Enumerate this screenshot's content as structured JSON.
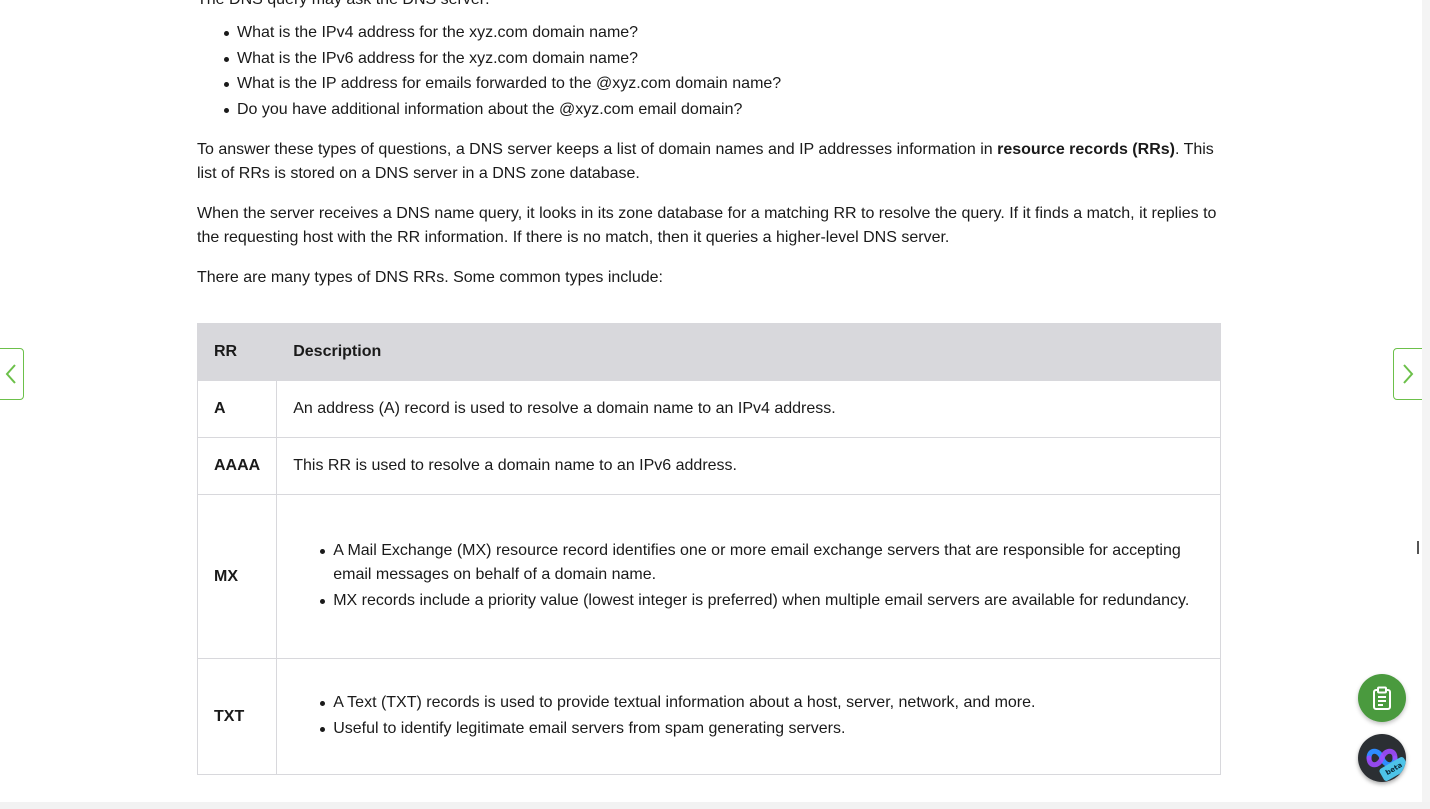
{
  "content": {
    "intro": "The DNS query may ask the DNS server:",
    "questions": [
      "What is the IPv4 address for the xyz.com domain name?",
      "What is the IPv6 address for the xyz.com domain name?",
      "What is the IP address for emails forwarded to the @xyz.com domain name?",
      "Do you have additional information about the @xyz.com email domain?"
    ],
    "para1_before": "To answer these types of questions, a DNS server keeps a list of domain names and IP addresses information in ",
    "para1_bold": "resource records (RRs)",
    "para1_after": ". This list of RRs is stored on a DNS server in a DNS zone database.",
    "para2": "When the server receives a DNS name query, it looks in its zone database for a matching RR to resolve the query. If it finds a match, it replies to the requesting host with the RR information. If there is no match, then it queries a higher-level DNS server.",
    "para3": "There are many types of DNS RRs. Some common types include:"
  },
  "table": {
    "headers": {
      "rr": "RR",
      "description": "Description"
    },
    "rows": [
      {
        "rr": "A",
        "description": "An address (A) record is used to resolve a domain name to an IPv4 address."
      },
      {
        "rr": "AAAA",
        "description": "This RR is used to resolve a domain name to an IPv6 address."
      },
      {
        "rr": "MX",
        "bullets": [
          "A Mail Exchange (MX) resource record identifies one or more email exchange servers that are responsible for accepting email messages on behalf of a domain name.",
          "MX records include a priority value (lowest integer is preferred) when multiple email servers are available for redundancy."
        ]
      },
      {
        "rr": "TXT",
        "bullets": [
          "A Text (TXT) records is used to provide textual information about a host, server, network, and more.",
          "Useful to identify legitimate email servers from spam generating servers."
        ]
      }
    ]
  },
  "icons": {
    "prev": "chevron-left-icon",
    "next": "chevron-right-icon",
    "notes": "clipboard-icon",
    "webex": "webex-icon"
  },
  "webex_badge": "beta",
  "colors": {
    "accent_green": "#6cc04a",
    "fab_green": "#4a9a3e",
    "table_header_bg": "#d8d8dc",
    "text": "#1a1a1a"
  }
}
